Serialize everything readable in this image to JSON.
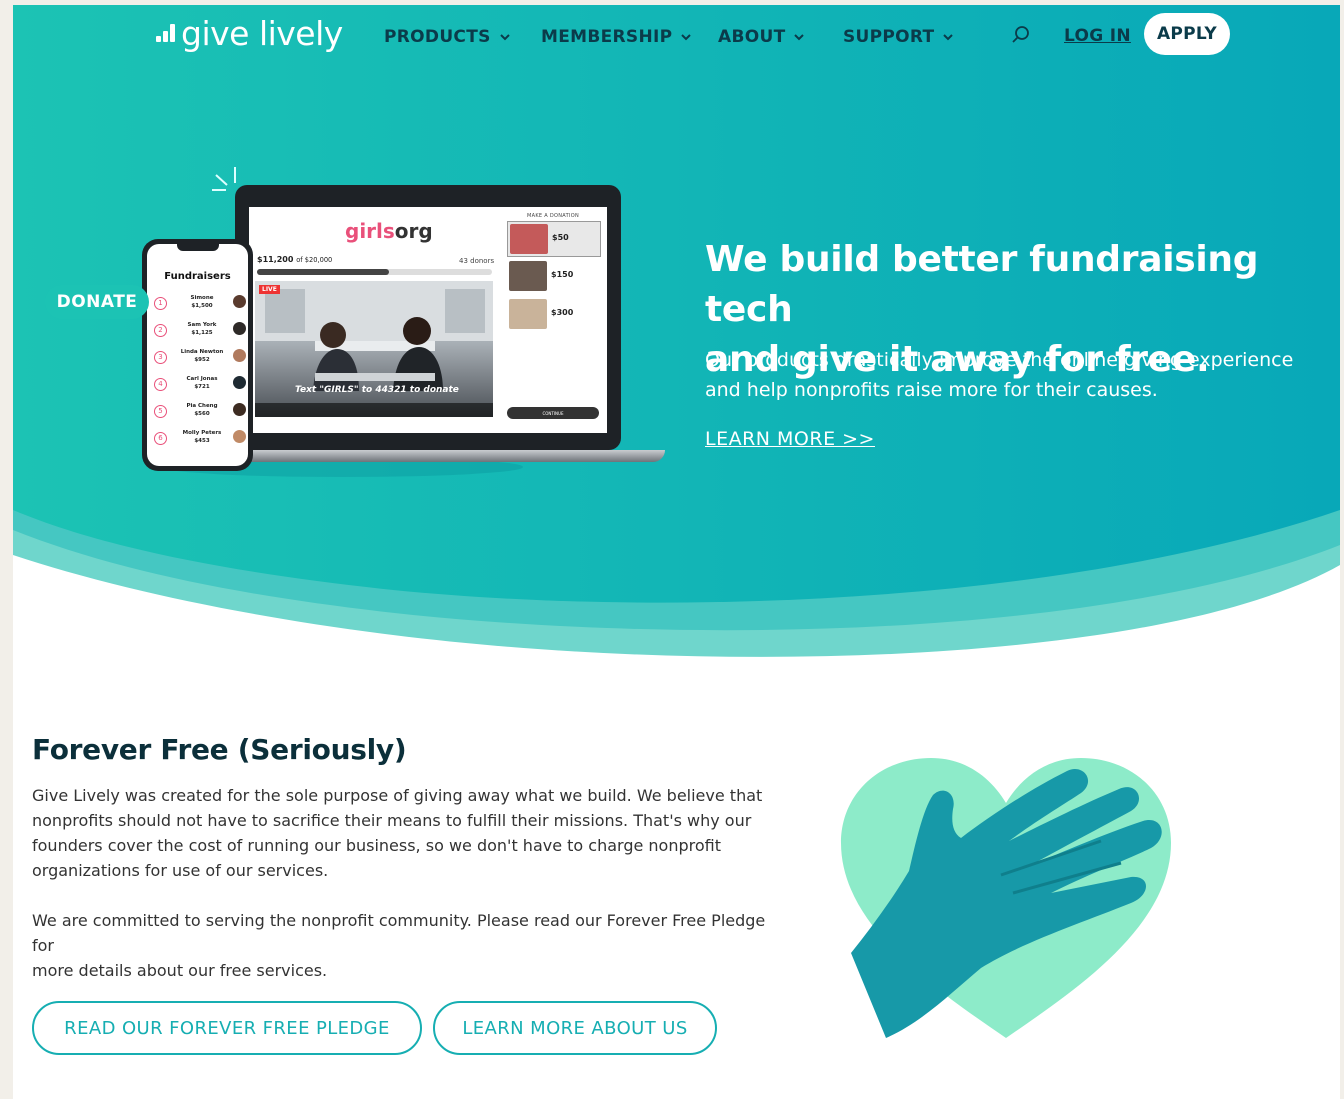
{
  "brand": {
    "name": "give lively"
  },
  "nav": {
    "items": [
      {
        "label": "PRODUCTS"
      },
      {
        "label": "MEMBERSHIP"
      },
      {
        "label": "ABOUT"
      },
      {
        "label": "SUPPORT"
      }
    ],
    "login_label": "LOG IN",
    "apply_label": "APPLY"
  },
  "hero": {
    "title_line1": "We build better fundraising tech",
    "title_line2": "and give it away for free.",
    "subtitle_line1": "Our products drastically improve the online giving experience",
    "subtitle_line2": "and help nonprofits raise more for their causes.",
    "cta_label": "LEARN MORE >>"
  },
  "illustration": {
    "donate_label": "DONATE",
    "org_prefix": "girls",
    "org_suffix": "org",
    "raised": "$11,200",
    "goal": "of $20,000",
    "donors": "43 donors",
    "progress": 0.56,
    "live_label": "LIVE",
    "video_caption": "Text \"GIRLS\" to 44321 to donate",
    "donation_panel_title": "MAKE A DONATION",
    "amounts": [
      "$50",
      "$150",
      "$300"
    ],
    "continue_label": "CONTINUE",
    "fundraisers_title": "Fundraisers",
    "fundraisers": [
      {
        "rank": "1",
        "name": "Simone",
        "amount": "$1,500"
      },
      {
        "rank": "2",
        "name": "Sam York",
        "amount": "$1,125"
      },
      {
        "rank": "3",
        "name": "Linda Newton",
        "amount": "$952"
      },
      {
        "rank": "4",
        "name": "Carl Jonas",
        "amount": "$721"
      },
      {
        "rank": "5",
        "name": "Pia Cheng",
        "amount": "$560"
      },
      {
        "rank": "6",
        "name": "Molly Peters",
        "amount": "$453"
      }
    ]
  },
  "forever_free": {
    "title": "Forever Free (Seriously)",
    "para1_lines": [
      "Give Lively was created for the sole purpose of giving away what we build. We believe that",
      "nonprofits should not have to sacrifice their means to fulfill their missions. That's why our",
      "founders cover the cost of running our business, so we don't have to charge nonprofit",
      "organizations for use of our services."
    ],
    "para2_lines": [
      "We are committed to serving the nonprofit community. Please read our Forever Free Pledge for",
      "more details about our free services."
    ],
    "pledge_button": "READ OUR FOREVER FREE PLEDGE",
    "about_button": "LEARN MORE ABOUT US"
  },
  "colors": {
    "teal_dark": "#0aacb6",
    "teal_light": "#1cc3b4",
    "nav_text": "#0b3b4a",
    "accent_outline": "#16aeb2",
    "heart_mint": "#8debc9",
    "hand_teal": "#1799a8"
  }
}
